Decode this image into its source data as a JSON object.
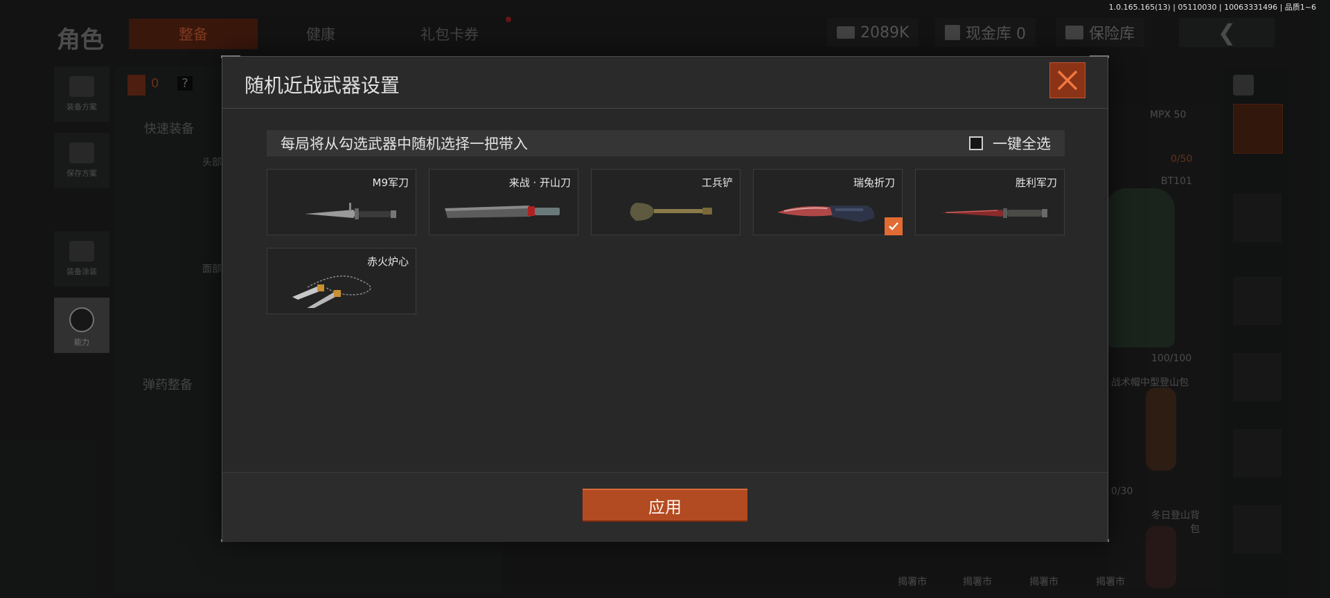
{
  "version_info": "1.0.165.165(13) | 05110030 | 10063331496 | 品质1~6",
  "background": {
    "page_title": "角色",
    "tabs": [
      "整备",
      "健康",
      "礼包卡券"
    ],
    "currency": "2089K",
    "cash_vault": "现金库 0",
    "safe_box": "保险库",
    "left_nav": [
      "装备方案",
      "保存方案",
      "装备涂装",
      "能力"
    ],
    "armor_count": "0",
    "quick_equip": "快速装备",
    "head_label": "头部",
    "face_label": "面部",
    "ammo_prep": "弹药整备",
    "right_items": {
      "weapon": "MPX 50",
      "capacity": "0/50",
      "armor": "BT101",
      "durability": "100/100",
      "helmet": "战术帽",
      "backpack1": "中型登山包",
      "backpack2": "冬日登山背包",
      "slot_count": "0/30",
      "bottom_labels": [
        "揭署市",
        "揭署市",
        "揭署市",
        "揭署市"
      ]
    }
  },
  "modal": {
    "title": "随机近战武器设置",
    "hint": "每局将从勾选武器中随机选择一把带入",
    "select_all": "一键全选",
    "apply": "应用",
    "weapons": [
      {
        "name": "M9军刀",
        "icon": "m9-knife-icon",
        "checked": false
      },
      {
        "name": "来战 · 开山刀",
        "icon": "machete-icon",
        "checked": false
      },
      {
        "name": "工兵铲",
        "icon": "shovel-icon",
        "checked": false
      },
      {
        "name": "瑞兔折刀",
        "icon": "folding-knife-icon",
        "checked": true
      },
      {
        "name": "胜利军刀",
        "icon": "victory-knife-icon",
        "checked": false
      },
      {
        "name": "赤火炉心",
        "icon": "chain-blades-icon",
        "checked": false
      }
    ]
  },
  "colors": {
    "accent": "#e26b33",
    "apply_button": "#b24a22",
    "close_button": "#8a3316"
  }
}
